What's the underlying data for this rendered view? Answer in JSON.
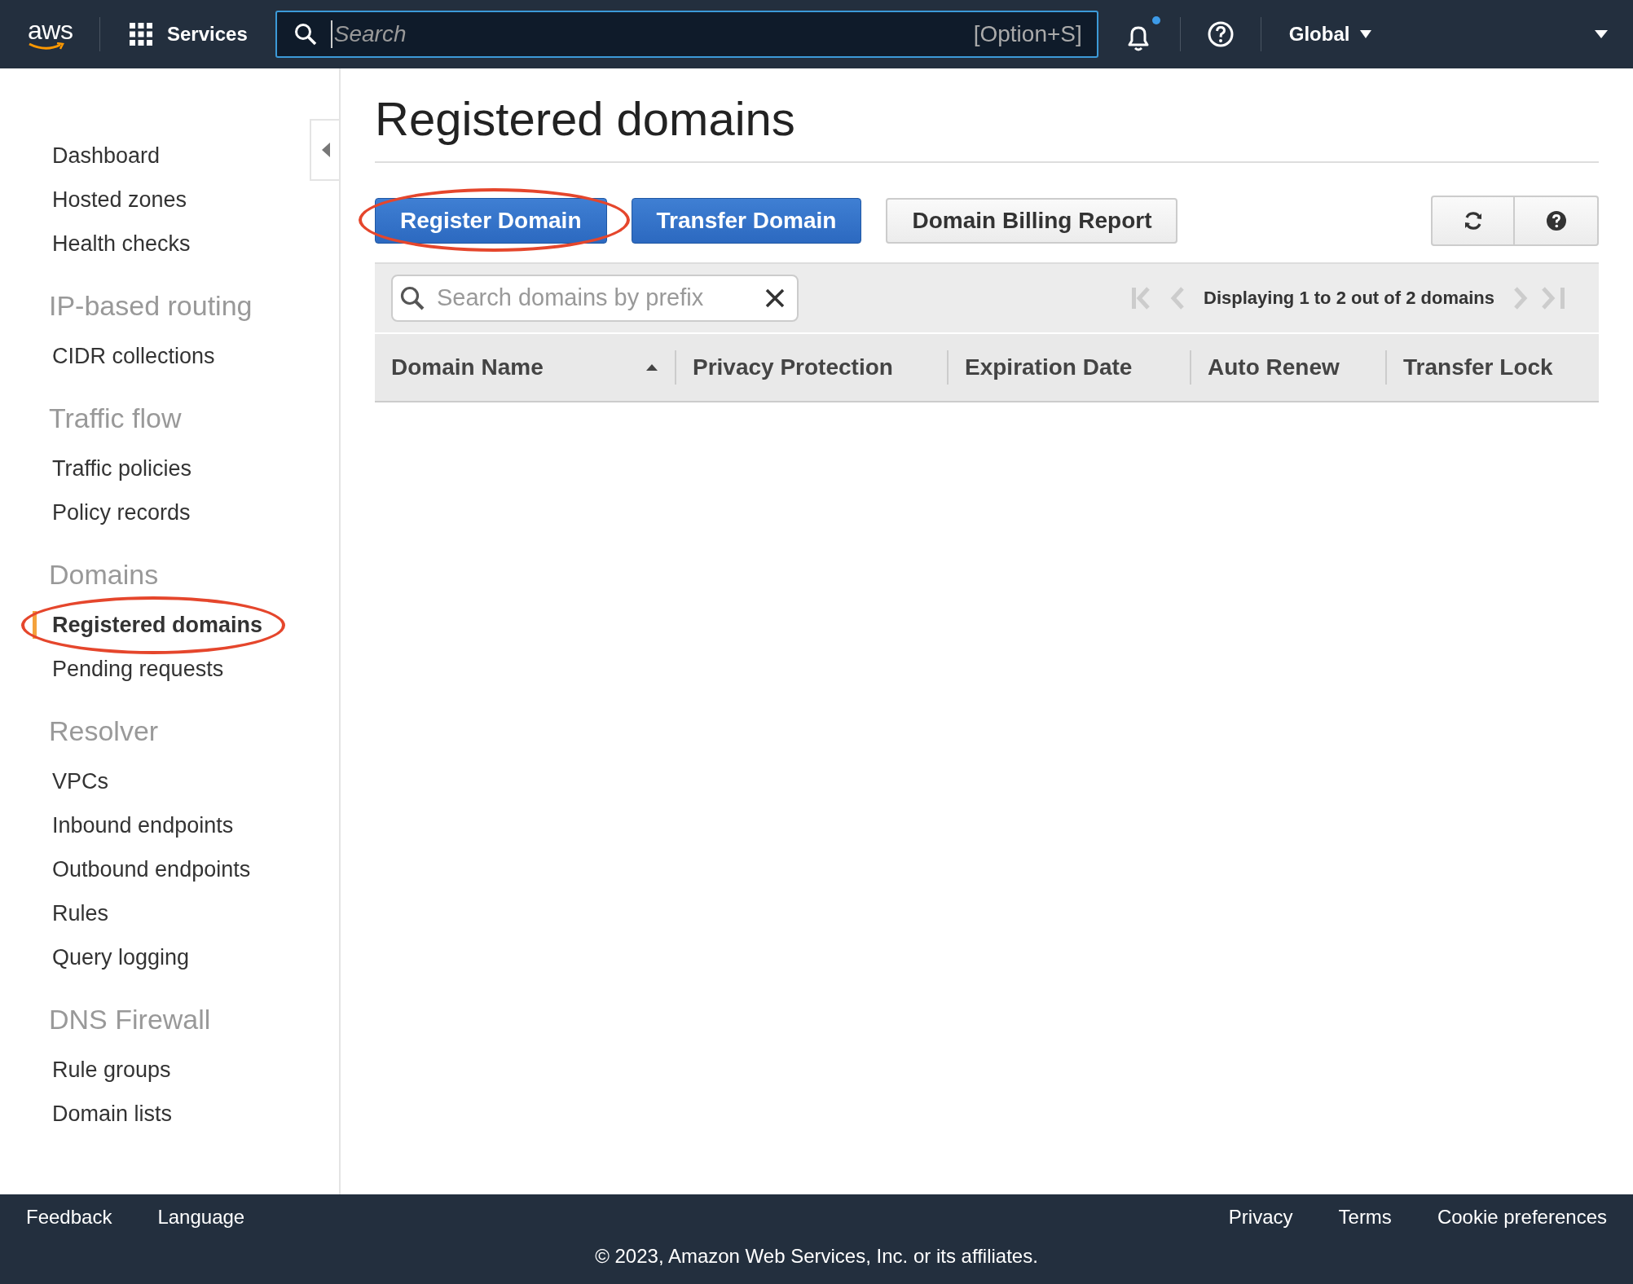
{
  "top_bar": {
    "logo": "aws",
    "services": "Services",
    "search": {
      "placeholder": "Search",
      "shortcut": "[Option+S]"
    },
    "notifications": {
      "unread": true
    },
    "region": "Global"
  },
  "sidebar": {
    "sections": [
      {
        "items": [
          {
            "label": "Dashboard",
            "selected": false,
            "circled": false
          },
          {
            "label": "Hosted zones",
            "selected": false,
            "circled": false
          },
          {
            "label": "Health checks",
            "selected": false,
            "circled": false
          }
        ]
      },
      {
        "heading": "IP-based routing",
        "items": [
          {
            "label": "CIDR collections",
            "selected": false,
            "circled": false
          }
        ]
      },
      {
        "heading": "Traffic flow",
        "items": [
          {
            "label": "Traffic policies",
            "selected": false,
            "circled": false
          },
          {
            "label": "Policy records",
            "selected": false,
            "circled": false
          }
        ]
      },
      {
        "heading": "Domains",
        "items": [
          {
            "label": "Registered domains",
            "selected": true,
            "circled": true
          },
          {
            "label": "Pending requests",
            "selected": false,
            "circled": false
          }
        ]
      },
      {
        "heading": "Resolver",
        "items": [
          {
            "label": "VPCs",
            "selected": false,
            "circled": false
          },
          {
            "label": "Inbound endpoints",
            "selected": false,
            "circled": false
          },
          {
            "label": "Outbound endpoints",
            "selected": false,
            "circled": false
          },
          {
            "label": "Rules",
            "selected": false,
            "circled": false
          },
          {
            "label": "Query logging",
            "selected": false,
            "circled": false
          }
        ]
      },
      {
        "heading": "DNS Firewall",
        "items": [
          {
            "label": "Rule groups",
            "selected": false,
            "circled": false
          },
          {
            "label": "Domain lists",
            "selected": false,
            "circled": false
          }
        ]
      }
    ]
  },
  "page": {
    "title": "Registered domains",
    "buttons": [
      {
        "label": "Register Domain",
        "kind": "primary",
        "circled": true
      },
      {
        "label": "Transfer Domain",
        "kind": "primary",
        "circled": false
      },
      {
        "label": "Domain Billing Report",
        "kind": "secondary",
        "circled": false
      }
    ],
    "toolbar": {
      "search_placeholder": "Search domains by prefix",
      "pagination": "Displaying 1 to 2 out of 2 domains"
    },
    "table": {
      "columns": [
        {
          "label": "Domain Name",
          "sorted": true
        },
        {
          "label": "Privacy Protection",
          "sorted": false
        },
        {
          "label": "Expiration Date",
          "sorted": false
        },
        {
          "label": "Auto Renew",
          "sorted": false
        },
        {
          "label": "Transfer Lock",
          "sorted": false
        }
      ]
    }
  },
  "footer": {
    "left_links": [
      "Feedback",
      "Language"
    ],
    "right_links": [
      "Privacy",
      "Terms",
      "Cookie preferences"
    ],
    "copyright": "© 2023, Amazon Web Services, Inc. or its affiliates."
  }
}
